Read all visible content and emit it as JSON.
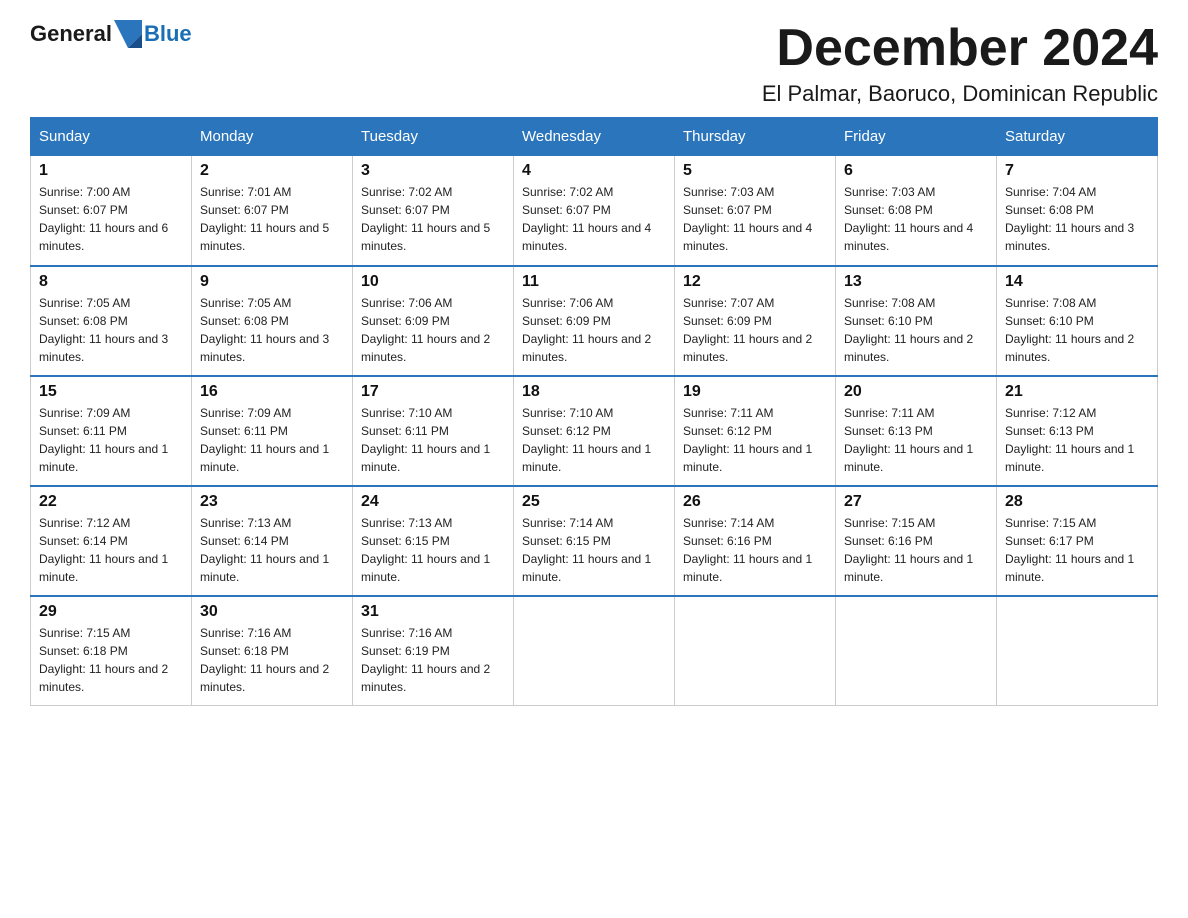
{
  "header": {
    "logo_text_general": "General",
    "logo_text_blue": "Blue",
    "month_title": "December 2024",
    "location": "El Palmar, Baoruco, Dominican Republic"
  },
  "days_of_week": [
    "Sunday",
    "Monday",
    "Tuesday",
    "Wednesday",
    "Thursday",
    "Friday",
    "Saturday"
  ],
  "weeks": [
    [
      {
        "day": "1",
        "sunrise": "7:00 AM",
        "sunset": "6:07 PM",
        "daylight": "11 hours and 6 minutes."
      },
      {
        "day": "2",
        "sunrise": "7:01 AM",
        "sunset": "6:07 PM",
        "daylight": "11 hours and 5 minutes."
      },
      {
        "day": "3",
        "sunrise": "7:02 AM",
        "sunset": "6:07 PM",
        "daylight": "11 hours and 5 minutes."
      },
      {
        "day": "4",
        "sunrise": "7:02 AM",
        "sunset": "6:07 PM",
        "daylight": "11 hours and 4 minutes."
      },
      {
        "day": "5",
        "sunrise": "7:03 AM",
        "sunset": "6:07 PM",
        "daylight": "11 hours and 4 minutes."
      },
      {
        "day": "6",
        "sunrise": "7:03 AM",
        "sunset": "6:08 PM",
        "daylight": "11 hours and 4 minutes."
      },
      {
        "day": "7",
        "sunrise": "7:04 AM",
        "sunset": "6:08 PM",
        "daylight": "11 hours and 3 minutes."
      }
    ],
    [
      {
        "day": "8",
        "sunrise": "7:05 AM",
        "sunset": "6:08 PM",
        "daylight": "11 hours and 3 minutes."
      },
      {
        "day": "9",
        "sunrise": "7:05 AM",
        "sunset": "6:08 PM",
        "daylight": "11 hours and 3 minutes."
      },
      {
        "day": "10",
        "sunrise": "7:06 AM",
        "sunset": "6:09 PM",
        "daylight": "11 hours and 2 minutes."
      },
      {
        "day": "11",
        "sunrise": "7:06 AM",
        "sunset": "6:09 PM",
        "daylight": "11 hours and 2 minutes."
      },
      {
        "day": "12",
        "sunrise": "7:07 AM",
        "sunset": "6:09 PM",
        "daylight": "11 hours and 2 minutes."
      },
      {
        "day": "13",
        "sunrise": "7:08 AM",
        "sunset": "6:10 PM",
        "daylight": "11 hours and 2 minutes."
      },
      {
        "day": "14",
        "sunrise": "7:08 AM",
        "sunset": "6:10 PM",
        "daylight": "11 hours and 2 minutes."
      }
    ],
    [
      {
        "day": "15",
        "sunrise": "7:09 AM",
        "sunset": "6:11 PM",
        "daylight": "11 hours and 1 minute."
      },
      {
        "day": "16",
        "sunrise": "7:09 AM",
        "sunset": "6:11 PM",
        "daylight": "11 hours and 1 minute."
      },
      {
        "day": "17",
        "sunrise": "7:10 AM",
        "sunset": "6:11 PM",
        "daylight": "11 hours and 1 minute."
      },
      {
        "day": "18",
        "sunrise": "7:10 AM",
        "sunset": "6:12 PM",
        "daylight": "11 hours and 1 minute."
      },
      {
        "day": "19",
        "sunrise": "7:11 AM",
        "sunset": "6:12 PM",
        "daylight": "11 hours and 1 minute."
      },
      {
        "day": "20",
        "sunrise": "7:11 AM",
        "sunset": "6:13 PM",
        "daylight": "11 hours and 1 minute."
      },
      {
        "day": "21",
        "sunrise": "7:12 AM",
        "sunset": "6:13 PM",
        "daylight": "11 hours and 1 minute."
      }
    ],
    [
      {
        "day": "22",
        "sunrise": "7:12 AM",
        "sunset": "6:14 PM",
        "daylight": "11 hours and 1 minute."
      },
      {
        "day": "23",
        "sunrise": "7:13 AM",
        "sunset": "6:14 PM",
        "daylight": "11 hours and 1 minute."
      },
      {
        "day": "24",
        "sunrise": "7:13 AM",
        "sunset": "6:15 PM",
        "daylight": "11 hours and 1 minute."
      },
      {
        "day": "25",
        "sunrise": "7:14 AM",
        "sunset": "6:15 PM",
        "daylight": "11 hours and 1 minute."
      },
      {
        "day": "26",
        "sunrise": "7:14 AM",
        "sunset": "6:16 PM",
        "daylight": "11 hours and 1 minute."
      },
      {
        "day": "27",
        "sunrise": "7:15 AM",
        "sunset": "6:16 PM",
        "daylight": "11 hours and 1 minute."
      },
      {
        "day": "28",
        "sunrise": "7:15 AM",
        "sunset": "6:17 PM",
        "daylight": "11 hours and 1 minute."
      }
    ],
    [
      {
        "day": "29",
        "sunrise": "7:15 AM",
        "sunset": "6:18 PM",
        "daylight": "11 hours and 2 minutes."
      },
      {
        "day": "30",
        "sunrise": "7:16 AM",
        "sunset": "6:18 PM",
        "daylight": "11 hours and 2 minutes."
      },
      {
        "day": "31",
        "sunrise": "7:16 AM",
        "sunset": "6:19 PM",
        "daylight": "11 hours and 2 minutes."
      },
      null,
      null,
      null,
      null
    ]
  ],
  "colors": {
    "header_bg": "#2a75bb",
    "accent_blue": "#1a6eb5"
  }
}
